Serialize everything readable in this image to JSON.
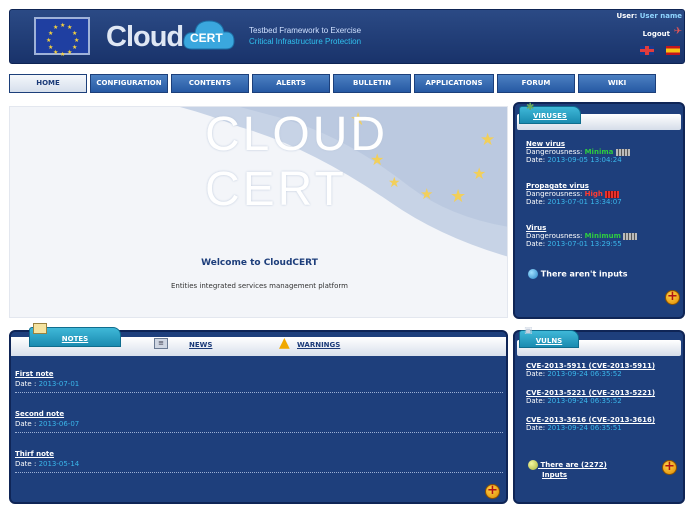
{
  "header": {
    "logo_word": "Cloud",
    "logo_badge": "CERT",
    "tagline_1": "Testbed Framework to Exercise",
    "tagline_2": "Critical Infrastructure Protection",
    "user_label": "User:",
    "user_name": "User name",
    "logout_label": "Logout"
  },
  "nav": {
    "tabs": [
      "HOME",
      "CONFIGURATION",
      "CONTENTS",
      "ALERTS",
      "BULLETIN",
      "APPLICATIONS",
      "FORUM",
      "WIKI"
    ],
    "active": "HOME"
  },
  "banner": {
    "title": "CLOUD CERT",
    "welcome": "Welcome to CloudCERT",
    "subtitle": "Entities integrated services management platform"
  },
  "viruses": {
    "tab_label": "VIRUSES",
    "items": [
      {
        "title": "New virus",
        "danger_label": "Dangerousness:",
        "level": "Minima",
        "date_label": "Date:",
        "date": "2013-09-05 13:04:24"
      },
      {
        "title": "Propagate virus",
        "danger_label": "Dangerousness:",
        "level": "High",
        "date_label": "Date:",
        "date": "2013-07-01 13:34:07"
      },
      {
        "title": "Virus",
        "danger_label": "Dangerousness:",
        "level": "Minimum",
        "date_label": "Date:",
        "date": "2013-07-01 13:29:55"
      }
    ],
    "empty_note": "There aren't inputs"
  },
  "notes": {
    "tabs": {
      "notes": "NOTES",
      "news": "NEWS",
      "warnings": "WARNINGS"
    },
    "items": [
      {
        "title": "First note",
        "date_label": "Date :",
        "date": "2013-07-01"
      },
      {
        "title": "Second note",
        "date_label": "Date :",
        "date": "2013-06-07"
      },
      {
        "title": "Thirf note",
        "date_label": "Date :",
        "date": "2013-05-14"
      }
    ]
  },
  "vulns": {
    "tab_label": "VULNS",
    "items": [
      {
        "title": "CVE-2013-5911 (CVE-2013-5911)",
        "date_label": "Date:",
        "date": "2013-09-24 06:35:52"
      },
      {
        "title": "CVE-2013-5221 (CVE-2013-5221)",
        "date_label": "Date:",
        "date": "2013-09-24 06:35:52"
      },
      {
        "title": "CVE-2013-3616 (CVE-2013-3616)",
        "date_label": "Date:",
        "date": "2013-09-24 06:35:51"
      }
    ],
    "count_note_line1": "There are (2272)",
    "count_note_line2": "Inputs"
  },
  "colors": {
    "header_bg": "#1e3f7c",
    "accent_cyan": "#2aa7cf",
    "date_blue": "#3ab6ea",
    "level_min": "#2ecc40",
    "level_high": "#ff3b30"
  }
}
